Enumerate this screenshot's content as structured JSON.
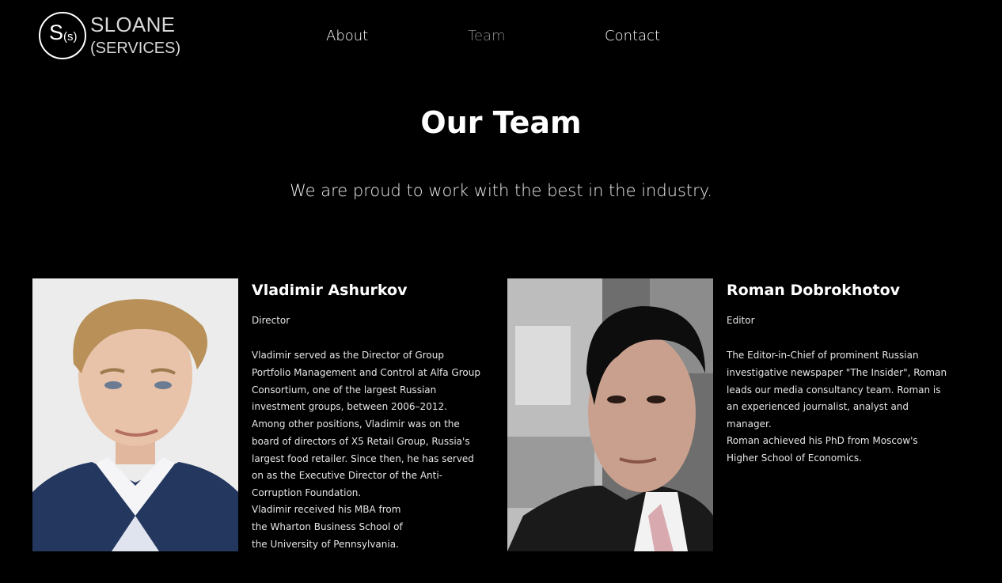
{
  "brand": {
    "mark_main": "S",
    "mark_sub": "(s)",
    "line1": "SLOANE",
    "line2": "(SERVICES)"
  },
  "nav": {
    "items": [
      {
        "label": "About"
      },
      {
        "label": "Team",
        "active": true
      },
      {
        "label": "Contact"
      }
    ]
  },
  "colors": {
    "background": "#000000",
    "text": "#ffffff",
    "nav_active": "#8a8a8a"
  },
  "page": {
    "title": "Our Team",
    "subtitle": "We are proud to work with the best in the industry."
  },
  "team": [
    {
      "name": "Vladimir Ashurkov",
      "role": "Director",
      "bio": [
        "Vladimir served as the Director of Group Portfolio Management and Control at Alfa Group Consortium, one of the largest Russian investment groups, between 2006–2012. Among other positions, Vladimir was on the board of directors of X5 Retail Group, Russia's largest food retailer. Since then, he has served on as the Executive Director of the Anti-Corruption Foundation.",
        "Vladimir received his MBA from the Wharton Business School of the University of Pennsylvania."
      ],
      "photo_icon": "portrait-photo"
    },
    {
      "name": "Roman Dobrokhotov",
      "role": "Editor",
      "bio": [
        "The Editor-in-Chief of prominent Russian investigative newspaper \"The Insider\", Roman leads our media consultancy team. Roman is an experienced journalist, analyst and manager.",
        "Roman achieved his PhD from Moscow's Higher School of Economics."
      ],
      "photo_icon": "portrait-photo"
    }
  ]
}
